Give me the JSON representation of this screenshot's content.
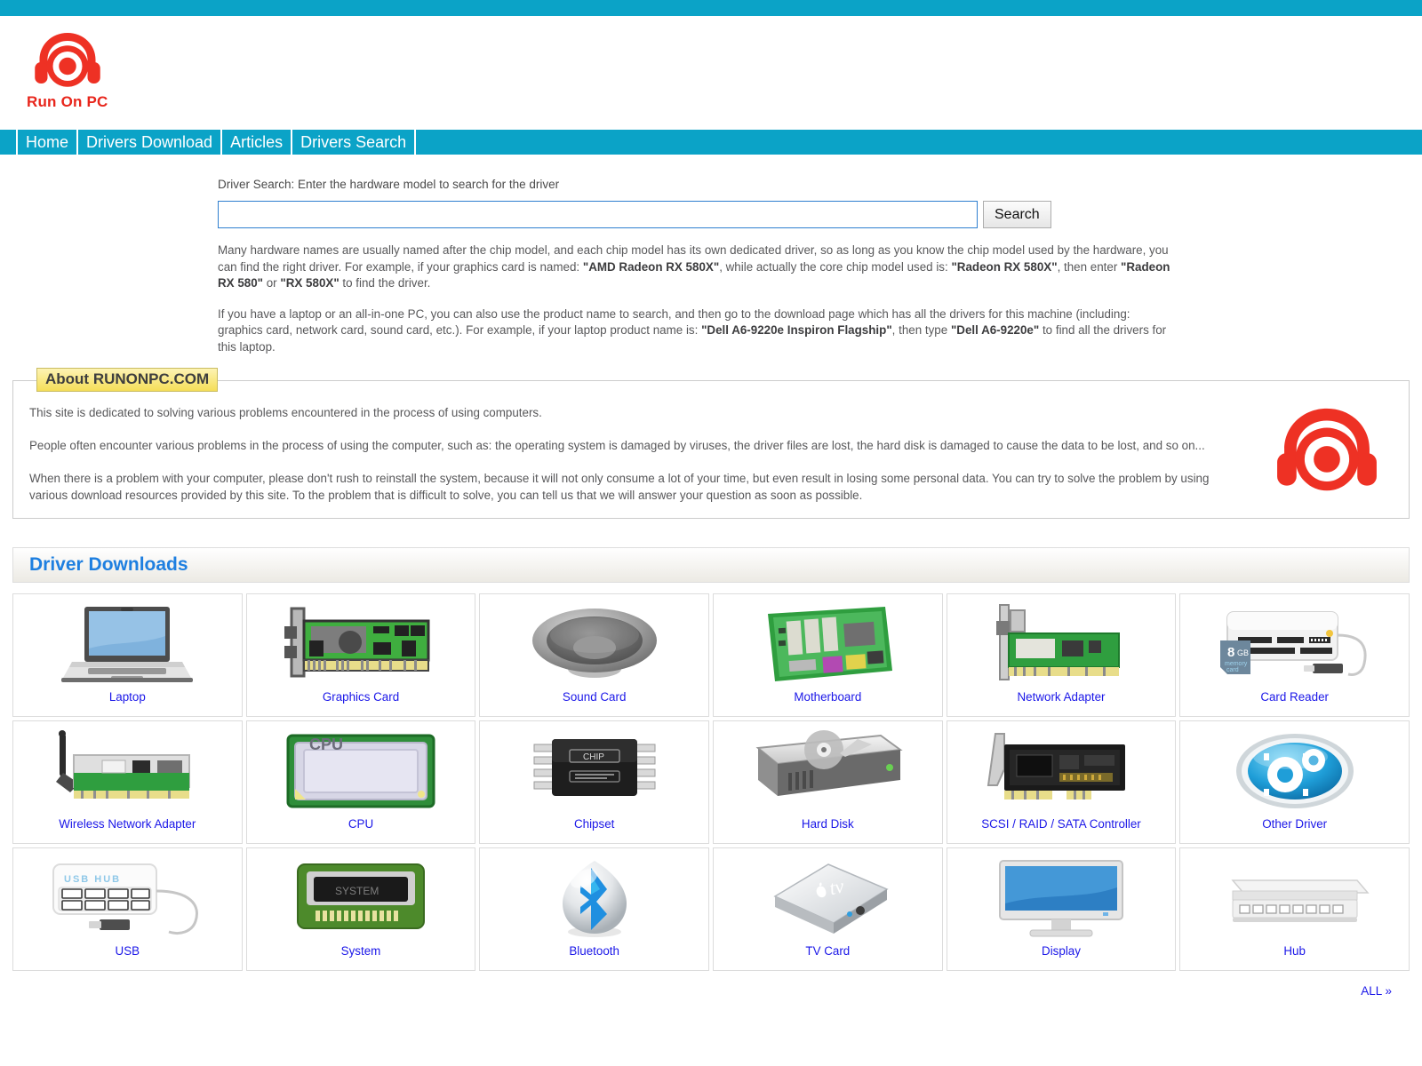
{
  "site": {
    "logo_text": "Run On PC",
    "logo_icon": "headphones-target-logo",
    "brand_red": "#e8261c",
    "brand_teal": "#0ba3c7",
    "link_blue": "#1b17e8"
  },
  "nav": {
    "items": [
      {
        "label": "Home"
      },
      {
        "label": "Drivers Download"
      },
      {
        "label": "Articles"
      },
      {
        "label": "Drivers Search"
      }
    ]
  },
  "search": {
    "label": "Driver Search: Enter the hardware model to search for the driver",
    "value": "",
    "placeholder": "",
    "button_label": "Search",
    "help_paragraph_1": "Many hardware names are usually named after the chip model, and each chip model has its own dedicated driver, so as long as you know the chip model used by the hardware, you can find the right driver. For example, if your graphics card is named: ",
    "help_1_b1": "\"AMD Radeon RX 580X\"",
    "help_1_mid1": ", while actually the core chip model used is: ",
    "help_1_b2": "\"Radeon RX 580X\"",
    "help_1_mid2": ", then enter ",
    "help_1_b3": "\"Radeon RX 580\"",
    "help_1_mid3": " or ",
    "help_1_b4": "\"RX 580X\"",
    "help_1_end": " to find the driver.",
    "help_paragraph_2": "If you have a laptop or an all-in-one PC, you can also use the product name to search, and then go to the download page which has all the drivers for this machine (including: graphics card, network card, sound card, etc.). For example, if your laptop product name is: ",
    "help_2_b1": "\"Dell A6-9220e Inspiron Flagship\"",
    "help_2_mid1": ", then type ",
    "help_2_b2": "\"Dell A6-9220e\"",
    "help_2_end": " to find all the drivers for this laptop."
  },
  "about": {
    "legend": "About RUNONPC.COM",
    "paragraphs": [
      "This site is dedicated to solving various problems encountered in the process of using computers.",
      "People often encounter various problems in the process of using the computer, such as: the operating system is damaged by viruses, the driver files are lost, the hard disk is damaged to cause the data to be lost, and so on...",
      "When there is a problem with your computer, please don't rush to reinstall the system, because it will not only consume a lot of your time, but even result in losing some personal data. You can try to solve the problem by using various download resources provided by this site. To the problem that is difficult to solve, you can tell us that we will answer your question as soon as possible."
    ]
  },
  "downloads": {
    "section_title": "Driver Downloads",
    "all_link": "ALL »",
    "categories": [
      {
        "label": "Laptop",
        "icon": "laptop-icon"
      },
      {
        "label": "Graphics Card",
        "icon": "graphics-card-icon"
      },
      {
        "label": "Sound Card",
        "icon": "speaker-icon"
      },
      {
        "label": "Motherboard",
        "icon": "motherboard-icon"
      },
      {
        "label": "Network Adapter",
        "icon": "network-adapter-icon"
      },
      {
        "label": "Card Reader",
        "icon": "card-reader-icon"
      },
      {
        "label": "Wireless Network Adapter",
        "icon": "wireless-network-adapter-icon"
      },
      {
        "label": "CPU",
        "icon": "cpu-icon"
      },
      {
        "label": "Chipset",
        "icon": "chipset-icon"
      },
      {
        "label": "Hard Disk",
        "icon": "hard-disk-icon"
      },
      {
        "label": "SCSI / RAID / SATA Controller",
        "icon": "scsi-raid-sata-controller-icon"
      },
      {
        "label": "Other Driver",
        "icon": "gears-disc-icon"
      },
      {
        "label": "USB",
        "icon": "usb-hub-icon"
      },
      {
        "label": "System",
        "icon": "system-chip-icon"
      },
      {
        "label": "Bluetooth",
        "icon": "bluetooth-icon"
      },
      {
        "label": "TV Card",
        "icon": "tv-box-icon"
      },
      {
        "label": "Display",
        "icon": "monitor-icon"
      },
      {
        "label": "Hub",
        "icon": "hub-icon"
      }
    ]
  }
}
